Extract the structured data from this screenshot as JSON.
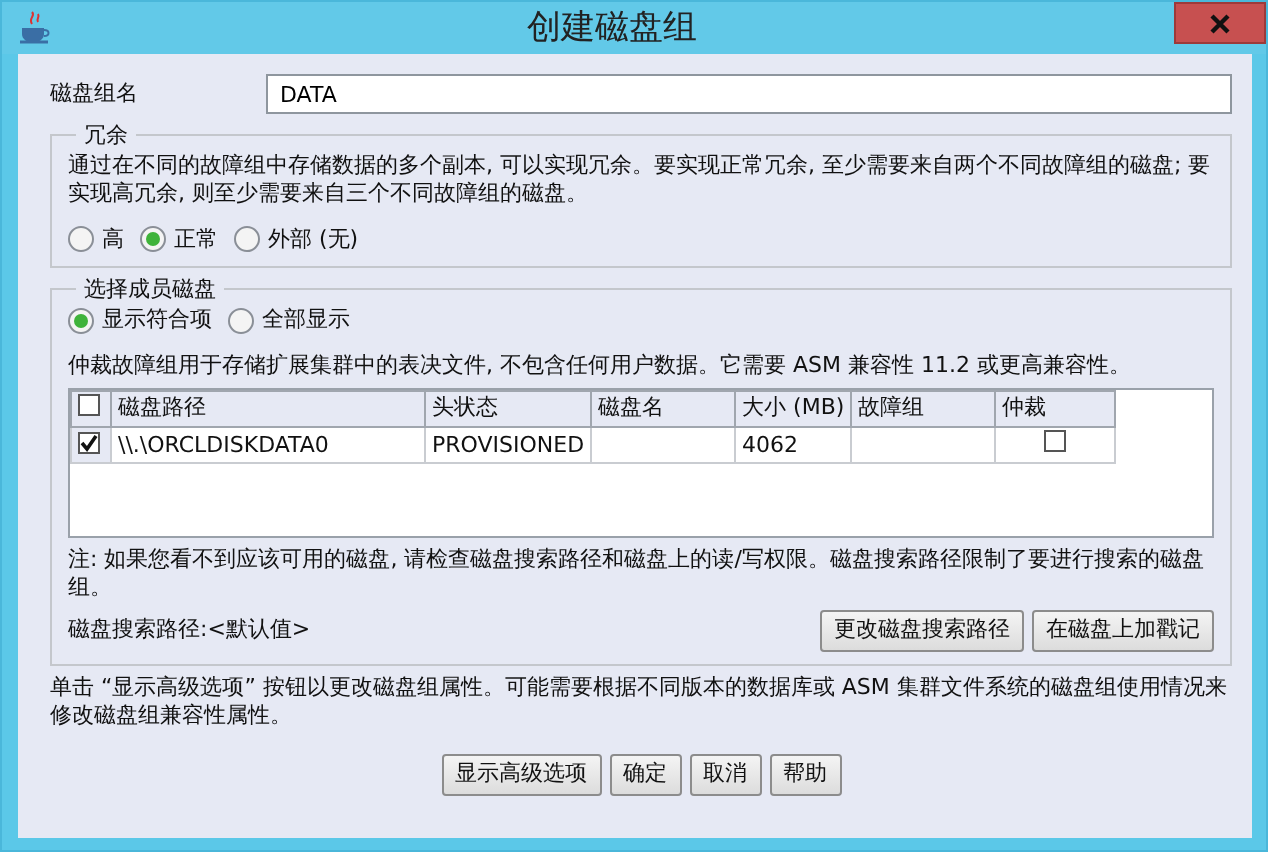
{
  "window": {
    "title": "创建磁盘组"
  },
  "disk_group_name": {
    "label": "磁盘组名",
    "value": "DATA"
  },
  "redundancy": {
    "legend": "冗余",
    "description": "通过在不同的故障组中存储数据的多个副本, 可以实现冗余。要实现正常冗余, 至少需要来自两个不同故障组的磁盘; 要实现高冗余, 则至少需要来自三个不同故障组的磁盘。",
    "options": [
      {
        "label": "高",
        "selected": false
      },
      {
        "label": "正常",
        "selected": true
      },
      {
        "label": "外部 (无)",
        "selected": false
      }
    ]
  },
  "member_disks": {
    "legend": "选择成员磁盘",
    "filters": [
      {
        "label": "显示符合项",
        "selected": true
      },
      {
        "label": "全部显示",
        "selected": false
      }
    ],
    "description": "仲裁故障组用于存储扩展集群中的表决文件, 不包含任何用户数据。它需要 ASM 兼容性 11.2 或更高兼容性。",
    "table": {
      "select_all_checked": false,
      "columns": [
        "磁盘路径",
        "头状态",
        "磁盘名",
        "大小 (MB)",
        "故障组",
        "仲裁"
      ],
      "rows": [
        {
          "checked": true,
          "cells": [
            "\\\\.\\ORCLDISKDATA0",
            "PROVISIONED",
            "",
            "4062",
            ""
          ],
          "quorum": false
        }
      ]
    },
    "note": "注: 如果您看不到应该可用的磁盘, 请检查磁盘搜索路径和磁盘上的读/写权限。磁盘搜索路径限制了要进行搜索的磁盘组。",
    "search_path": "磁盘搜索路径:<默认值>",
    "buttons": [
      "更改磁盘搜索路径",
      "在磁盘上加戳记"
    ]
  },
  "advanced_note": "单击 “显示高级选项” 按钮以更改磁盘组属性。可能需要根据不同版本的数据库或 ASM 集群文件系统的磁盘组使用情况来修改磁盘组兼容性属性。",
  "buttons": [
    "显示高级选项",
    "确定",
    "取消",
    "帮助"
  ]
}
